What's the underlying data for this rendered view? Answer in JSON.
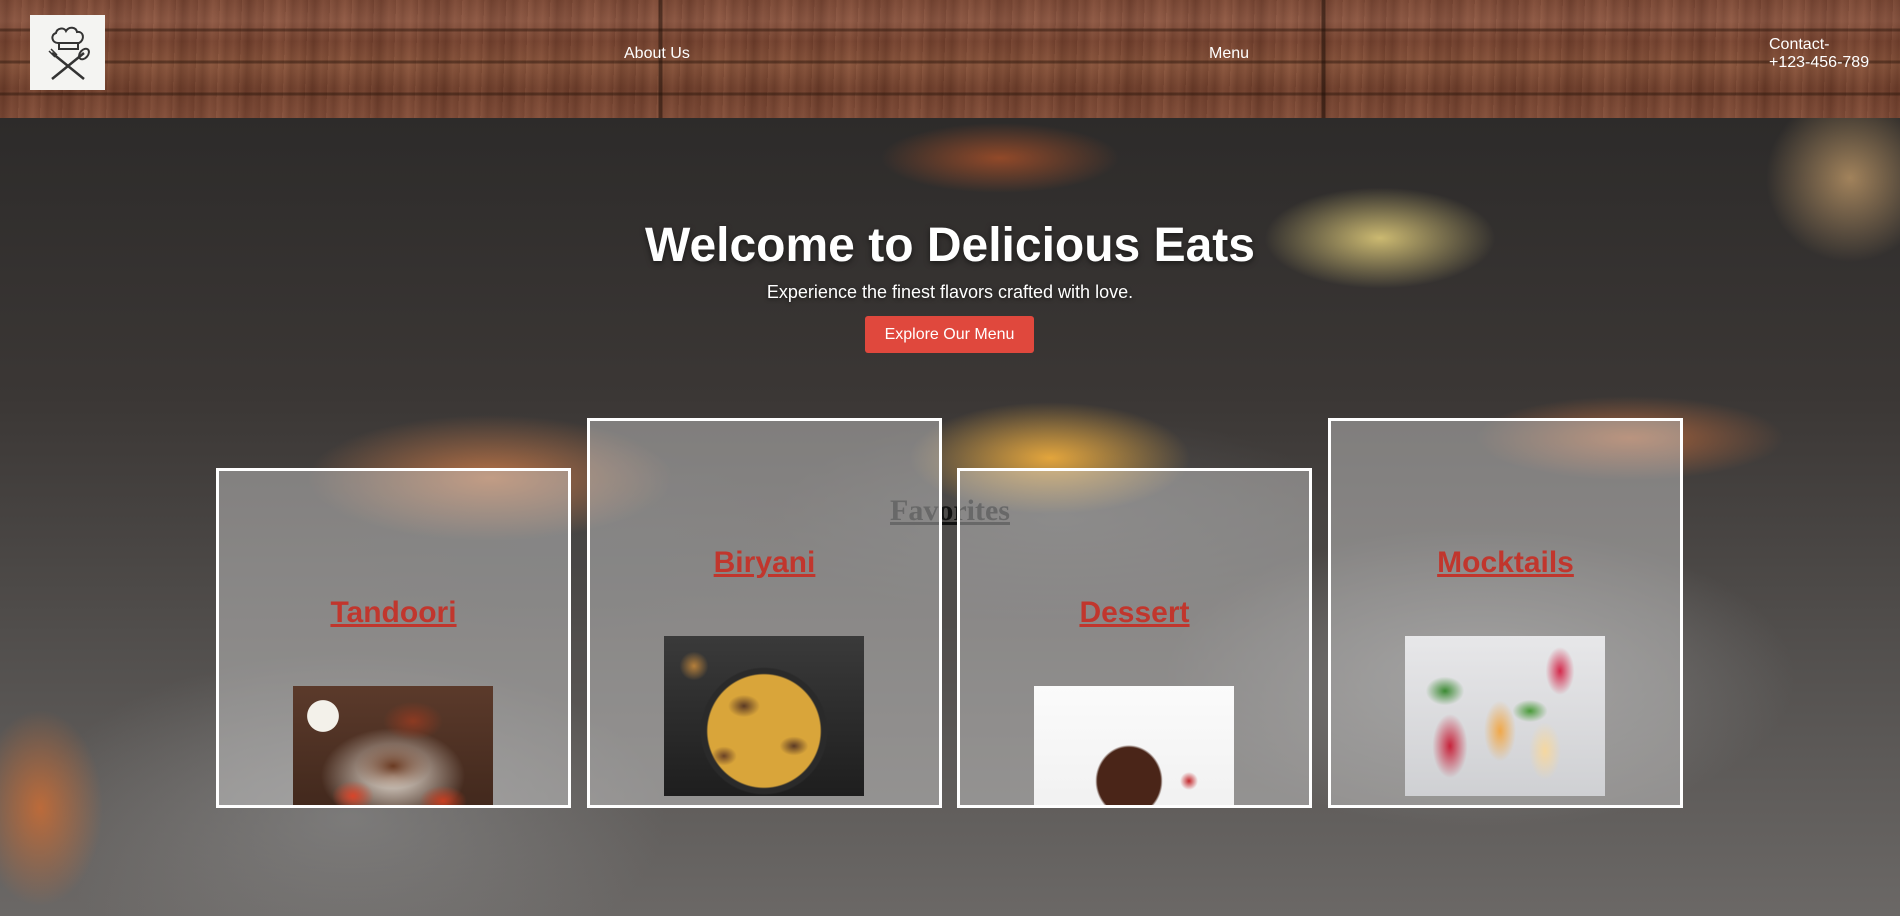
{
  "header": {
    "logo_name": "chef-hat-logo",
    "nav": {
      "about_label": "About Us",
      "menu_label": "Menu"
    },
    "contact_label": "Contact-",
    "contact_phone": "+123-456-789"
  },
  "hero": {
    "title": "Welcome to Delicious Eats",
    "subtitle": "Experience the finest flavors crafted with love.",
    "cta_label": "Explore Our Menu"
  },
  "favorites": {
    "heading": "Favorites",
    "items": [
      {
        "label": "Tandoori",
        "image": "tandoori-photo"
      },
      {
        "label": "Biryani",
        "image": "biryani-photo"
      },
      {
        "label": "Dessert",
        "image": "dessert-photo"
      },
      {
        "label": "Mocktails",
        "image": "mocktails-photo"
      }
    ]
  },
  "colors": {
    "accent_button": "#e0483d",
    "card_title": "#c1362d",
    "text_light": "#ffffff"
  }
}
